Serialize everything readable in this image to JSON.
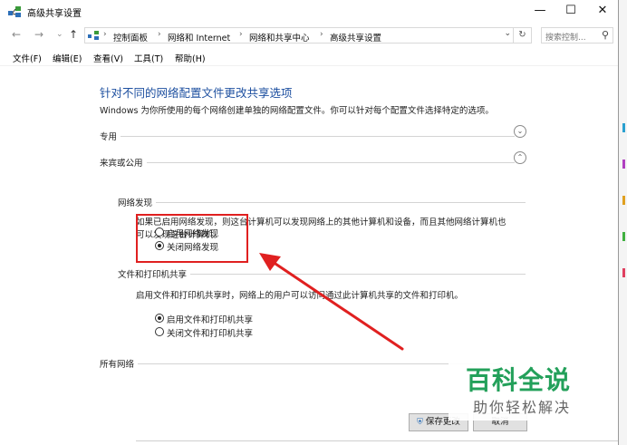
{
  "window": {
    "title": "高级共享设置",
    "minimize_glyph": "—",
    "maximize_glyph": "☐",
    "close_glyph": "✕"
  },
  "nav": {
    "back_glyph": "←",
    "forward_glyph": "→",
    "recent_glyph": "⌄",
    "up_glyph": "↑"
  },
  "address": {
    "crumbs": [
      "控制面板",
      "网络和 Internet",
      "网络和共享中心",
      "高级共享设置"
    ],
    "separator": "›",
    "dropdown_glyph": "⌄",
    "refresh_glyph": "↻"
  },
  "search": {
    "placeholder": "搜索控制...",
    "icon_glyph": "⚲"
  },
  "menu": [
    "文件(F)",
    "编辑(E)",
    "查看(V)",
    "工具(T)",
    "帮助(H)"
  ],
  "content": {
    "heading": "针对不同的网络配置文件更改共享选项",
    "description": "Windows 为你所使用的每个网络创建单独的网络配置文件。你可以针对每个配置文件选择特定的选项。",
    "private_label": "专用",
    "guest_label": "来宾或公用",
    "network_discovery": {
      "title": "网络发现",
      "description_line1": "如果已启用网络发现，则这台计算机可以发现网络上的其他计算机和设备，而且其他网络计算机也",
      "description_line2": "可以发现这台计算机。",
      "options": [
        {
          "label": "启用网络发现",
          "selected": false
        },
        {
          "label": "关闭网络发现",
          "selected": true
        }
      ]
    },
    "file_printer_sharing": {
      "title": "文件和打印机共享",
      "description": "启用文件和打印机共享时，网络上的用户可以访问通过此计算机共享的文件和打印机。",
      "options": [
        {
          "label": "启用文件和打印机共享",
          "selected": true
        },
        {
          "label": "关闭文件和打印机共享",
          "selected": false
        }
      ]
    },
    "all_networks_label": "所有网络",
    "collapse_glyph_down": "⌄",
    "collapse_glyph_up": "⌃"
  },
  "buttons": {
    "save": "保存更改",
    "cancel": "取消"
  },
  "watermark": {
    "line1": "百科全说",
    "line2": "助你轻松解决"
  },
  "colors": {
    "heading": "#1e50a0",
    "highlight_box": "#e02020",
    "arrow": "#e02020",
    "watermark": "#23a05a"
  }
}
